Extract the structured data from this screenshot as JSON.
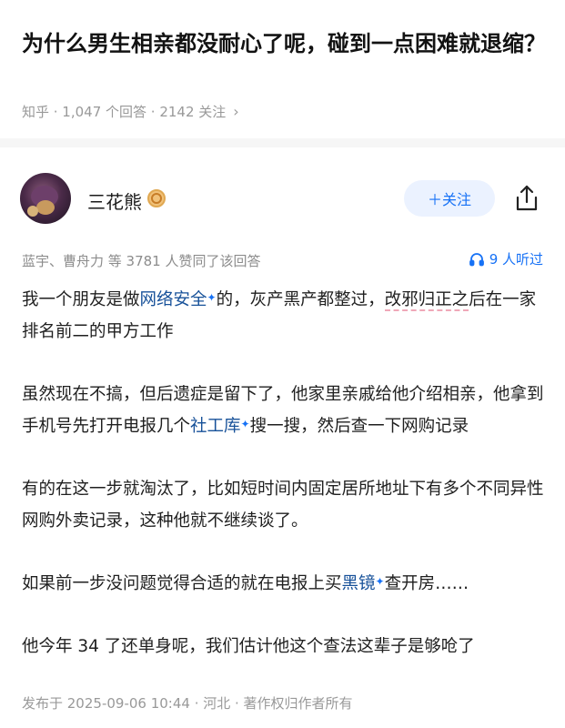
{
  "question": {
    "title": "为什么男生相亲都没耐心了呢，碰到一点困难就退缩？",
    "meta": "知乎 · 1,047 个回答 · 2142 关注",
    "chevron": "›"
  },
  "author": {
    "name": "三花熊",
    "follow_label": "＋关注",
    "avatar_icon": "avatar",
    "badge_icon": "creator-badge-icon"
  },
  "endorse": {
    "text": "蓝宇、曹舟力 等 3781 人赞同了该回答",
    "listen_text": "9 人听过"
  },
  "answer": {
    "p1_a": "我一个朋友是做",
    "p1_kw": "网络安全",
    "p1_b": "的，灰产黑产都整过，",
    "p1_wavy": "改邪归正之",
    "p1_c": "后在一家排名前二的甲方工作",
    "p2_a": "虽然现在不搞，但后遗症是留下了，他家里亲戚给他介绍相亲，他拿到手机号先打开电报几个",
    "p2_kw": "社工库",
    "p2_b": "搜一搜，然后查一下网购记录",
    "p3": "有的在这一步就淘汰了，比如短时间内固定居所地址下有多个不同异性网购外卖记录，这种他就不继续谈了。",
    "p4_a": "如果前一步没问题觉得合适的就在电报上买",
    "p4_kw": "黑镜",
    "p4_b": "查开房……",
    "p5": "他今年 34 了还单身呢，我们估计他这个查法这辈子是够呛了",
    "keyword_plus": "✦"
  },
  "footer": {
    "text": "发布于 2025-09-06 10:44 · 河北 · 著作权归作者所有"
  },
  "colors": {
    "accent": "#1772f6",
    "link": "#175199",
    "meta_gray": "#999999"
  }
}
